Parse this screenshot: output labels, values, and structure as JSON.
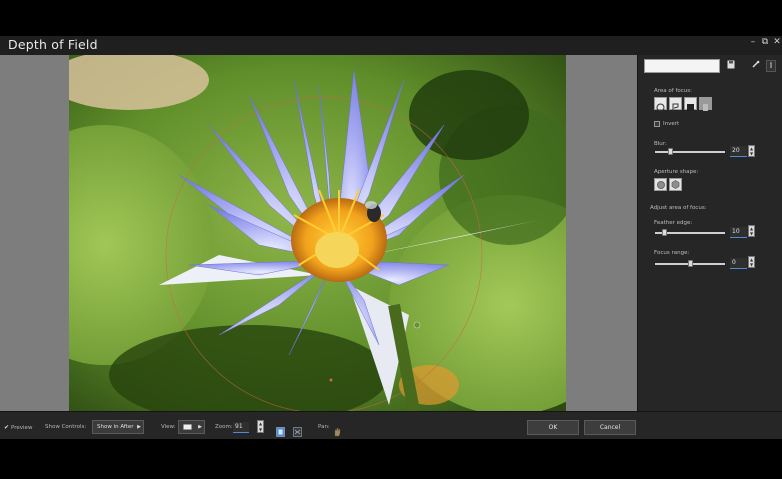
{
  "window": {
    "title": "Depth of Field",
    "controls": {
      "minimize": "–",
      "restore": "⧉",
      "close": "✕"
    }
  },
  "panel": {
    "preset_value": "",
    "area_label": "Area of focus:",
    "invert_label": "Invert",
    "blur_label": "Blur:",
    "blur_value": "20",
    "blur_fraction": 0.2,
    "aperture_label": "Aperture shape:",
    "adjust_label": "Adjust area of focus:",
    "feather_label": "Feather edge:",
    "feather_value": "10",
    "feather_fraction": 0.1,
    "range_label": "Focus range:",
    "range_value": "0",
    "range_fraction": 0.5
  },
  "bottom": {
    "preview_label": "Preview",
    "show_controls_label": "Show Controls:",
    "show_controls_value": "Show in After",
    "view_label": "View:",
    "zoom_label": "Zoom:",
    "zoom_value": "91",
    "pan_label": "Pan:",
    "ok_label": "OK",
    "cancel_label": "Cancel"
  },
  "colors": {
    "accent": "#4a8be0",
    "panel_bg": "#262626",
    "canvas_bg": "#7d7d7d"
  }
}
